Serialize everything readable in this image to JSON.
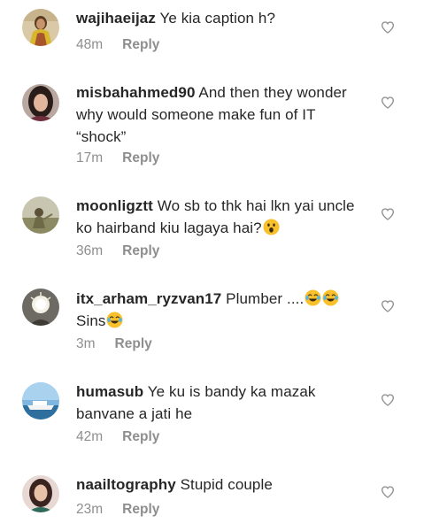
{
  "comments": [
    {
      "username": "wajihaeijaz",
      "text": " Ye kia caption h?",
      "time": "48m",
      "reply": "Reply"
    },
    {
      "username": "misbahahmed90",
      "text": " And then they wonder why would someone make fun of IT “shock”",
      "time": "17m",
      "reply": "Reply"
    },
    {
      "username": "moonligztt",
      "text": " Wo sb to thk hai lkn yai uncle ko hairband kiu lagaya hai?",
      "time": "36m",
      "reply": "Reply"
    },
    {
      "username": "itx_arham_ryzvan17",
      "text": " Plumber ....",
      "text2": "Sins",
      "time": "3m",
      "reply": "Reply"
    },
    {
      "username": "humasub",
      "text": " Ye ku is bandy ka mazak banvane a jati he",
      "time": "42m",
      "reply": "Reply"
    },
    {
      "username": "naailtography",
      "text": " Stupid couple",
      "time": "23m",
      "reply": "Reply"
    }
  ],
  "icons": {
    "like": "heart-outline-icon",
    "astonished_emoji": "astonished-face-emoji",
    "laughing_emoji": "face-with-tears-of-joy-emoji"
  },
  "colors": {
    "text": "#262626",
    "meta": "#8e8e8e",
    "emoji_yellow": "#f8c12c"
  }
}
